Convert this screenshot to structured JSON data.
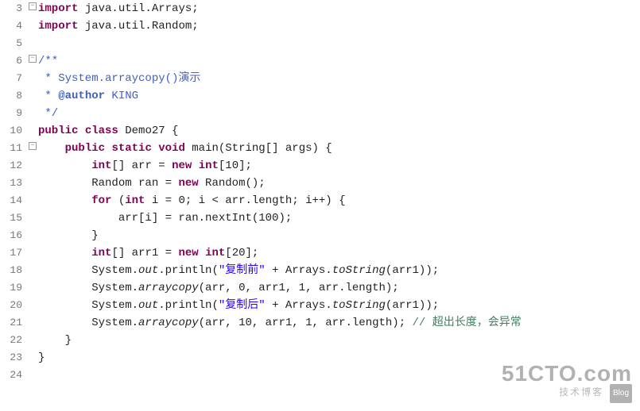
{
  "lines": [
    {
      "num": "3",
      "fold": "minus",
      "html": "<span class='kw'>import</span> java.util.Arrays;"
    },
    {
      "num": "4",
      "fold": "",
      "html": "<span class='kw'>import</span> java.util.Random;"
    },
    {
      "num": "5",
      "fold": "",
      "html": ""
    },
    {
      "num": "6",
      "fold": "minus",
      "html": "<span class='cm'>/**</span>"
    },
    {
      "num": "7",
      "fold": "",
      "html": "<span class='cm'> * System.arraycopy()演示</span>"
    },
    {
      "num": "8",
      "fold": "",
      "html": "<span class='cm'> * </span><span class='ctag'><b>@author</b></span><span class='cm'> KING</span>"
    },
    {
      "num": "9",
      "fold": "",
      "html": "<span class='cm'> */</span>"
    },
    {
      "num": "10",
      "fold": "",
      "html": "<span class='kw'>public</span> <span class='kw'>class</span> Demo27 {"
    },
    {
      "num": "11",
      "fold": "minus",
      "html": "    <span class='kw'>public</span> <span class='kw'>static</span> <span class='kw'>void</span> main(String[] args) {"
    },
    {
      "num": "12",
      "fold": "",
      "html": "        <span class='kw'>int</span>[] arr = <span class='kw'>new</span> <span class='kw'>int</span>[10];"
    },
    {
      "num": "13",
      "fold": "",
      "html": "        Random ran = <span class='kw'>new</span> Random();"
    },
    {
      "num": "14",
      "fold": "",
      "html": "        <span class='kw'>for</span> (<span class='kw'>int</span> i = 0; i &lt; arr.length; i++) {"
    },
    {
      "num": "15",
      "fold": "",
      "html": "            arr[i] = ran.nextInt(100);"
    },
    {
      "num": "16",
      "fold": "",
      "html": "        }"
    },
    {
      "num": "17",
      "fold": "",
      "html": "        <span class='kw'>int</span>[] arr1 = <span class='kw'>new</span> <span class='kw'>int</span>[20];"
    },
    {
      "num": "18",
      "fold": "",
      "html": "        System.<span class='sta'>out</span>.println(<span class='str'>\"复制前\"</span> + Arrays.<span class='sta'>toString</span>(arr1));"
    },
    {
      "num": "19",
      "fold": "",
      "html": "        System.<span class='sta'>arraycopy</span>(arr, 0, arr1, 1, arr.length);"
    },
    {
      "num": "20",
      "fold": "",
      "html": "        System.<span class='sta'>out</span>.println(<span class='str'>\"复制后\"</span> + Arrays.<span class='sta'>toString</span>(arr1));"
    },
    {
      "num": "21",
      "fold": "",
      "html": "        System.<span class='sta'>arraycopy</span>(arr, 10, arr1, 1, arr.length); <span class='comline'>// 超出长度，会异常</span>"
    },
    {
      "num": "22",
      "fold": "",
      "html": "    }"
    },
    {
      "num": "23",
      "fold": "",
      "html": "}"
    },
    {
      "num": "24",
      "fold": "",
      "html": ""
    }
  ],
  "watermark": {
    "big": "51CTO.com",
    "small": "技术博客",
    "blog": "Blog"
  }
}
